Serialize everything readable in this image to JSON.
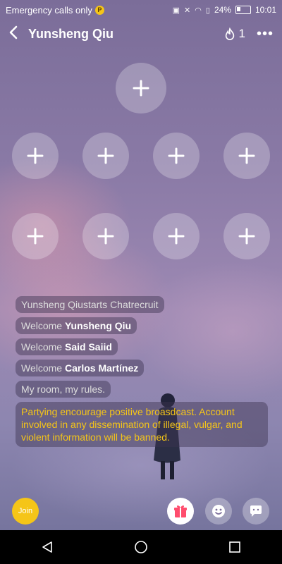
{
  "status_bar": {
    "carrier": "Emergency calls only",
    "p_badge": "P",
    "battery": "24%",
    "time": "10:01",
    "icons": [
      "nfc-icon",
      "mute-icon",
      "wifi-icon",
      "sim-icon",
      "battery-icon"
    ]
  },
  "header": {
    "title": "Yunsheng Qiu",
    "hot_count": "1",
    "icons": [
      "back-icon",
      "flame-icon",
      "more-icon"
    ]
  },
  "seats": {
    "host_icon": "plus-icon",
    "row1_icon": "plus-icon",
    "row2_icon": "plus-icon"
  },
  "chat": {
    "messages": [
      {
        "prefix": "Yunsheng Qiustarts Chatrecruit",
        "name": ""
      },
      {
        "prefix": "Welcome ",
        "name": "Yunsheng Qiu"
      },
      {
        "prefix": "Welcome ",
        "name": "Said Saiid"
      },
      {
        "prefix": "Welcome ",
        "name": "Carlos Martínez"
      },
      {
        "prefix": "My room, my rules.",
        "name": ""
      }
    ],
    "notice": "Partying encourage positive broasdcast. Account involved in any dissemination of illegal, vulgar, and violent information will be banned."
  },
  "controls": {
    "join_label": "Join",
    "icons": [
      "gift-icon",
      "emoji-icon",
      "chat-bubble-icon"
    ]
  },
  "navbar": {
    "icons": [
      "back-triangle-icon",
      "home-circle-icon",
      "recents-square-icon"
    ]
  },
  "colors": {
    "accent": "#f5c518",
    "notice_text": "#f5c518"
  }
}
